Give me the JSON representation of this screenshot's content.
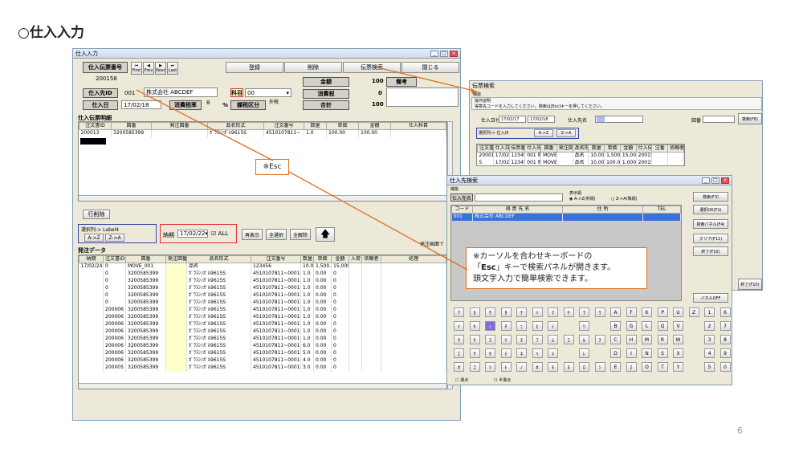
{
  "slide": {
    "title": "○仕入入力",
    "page": "6"
  },
  "main": {
    "title": "仕入入力",
    "denpyo_label": "仕入伝票番号",
    "denpyo_value": "200158",
    "nav": [
      "First",
      "Prev",
      "Next",
      "Last"
    ],
    "buttons": {
      "register": "登録",
      "delete": "削除",
      "search": "伝票検索",
      "close": "閉じる",
      "redisplay": "再表示",
      "selectall": "全選択",
      "clearall": "全解除",
      "rowdelete": "行削除"
    },
    "supplier_label": "仕入先ID",
    "supplier_id": "001",
    "supplier_name": "株式会社 ABCDEF",
    "kamoku_label": "科目",
    "kamoku_value": "00",
    "date_label": "仕入日",
    "date_value": "17/02/18",
    "tax_rate_label": "消費税率",
    "tax_rate_value": "8",
    "percent": "%",
    "tax_class_label": "課税区分",
    "tax_class_value": "外税",
    "kingaku_label": "金額",
    "kingaku_value": "100",
    "biko_label": "備考",
    "shohizei_label": "消費税",
    "shohizei_value": "0",
    "gokei_label": "合計",
    "gokei_value": "100",
    "detail_title": "仕入伝票明細",
    "detail_headers": [
      "注文書ID",
      "図番",
      "発注図番",
      "品名形式",
      "注文番号",
      "数量",
      "単価",
      "金額",
      "仕入科目"
    ],
    "detail_rows": [
      [
        "200013",
        "3200585399",
        "",
        "ｶﾞﾗｽｼﾝｶﾞﾙ9615S",
        "4510107811~",
        "1.0",
        "100.00",
        "100.00",
        ""
      ]
    ],
    "select_label": "選択列-> Label4",
    "sort_az": "A->Z",
    "sort_za": "Z->A",
    "nouki_label": "納期",
    "nouki_value": "17/02/22",
    "all_label": "ALL",
    "order_screen": "発注画面で",
    "order_title": "発注データ",
    "order_headers": [
      "納期",
      "注文書ID",
      "図番",
      "発注図番",
      "品名形式",
      "注文番号",
      "数量",
      "単価",
      "金額",
      "入荷",
      "依頼者",
      "処理"
    ],
    "order_rows": [
      [
        "17/02/24",
        "0",
        "MOVE_001",
        "",
        "品名",
        "123456",
        "10.0",
        "1,500.00",
        "15,000",
        "",
        "",
        ""
      ],
      [
        "",
        "0",
        "3200585399",
        "",
        "ｶﾞﾗｽｼﾝｶﾞﾙ9615S",
        "4510107811~00010",
        "1.0",
        "0.00",
        "0",
        "",
        "",
        ""
      ],
      [
        "",
        "0",
        "3200585399",
        "",
        "ｶﾞﾗｽｼﾝｶﾞﾙ9615S",
        "4510107811~00010",
        "1.0",
        "0.00",
        "0",
        "",
        "",
        ""
      ],
      [
        "",
        "0",
        "3200585399",
        "",
        "ｶﾞﾗｽｼﾝｶﾞﾙ9615S",
        "4510107811~00010",
        "1.0",
        "0.00",
        "0",
        "",
        "",
        ""
      ],
      [
        "",
        "0",
        "3200585399",
        "",
        "ｶﾞﾗｽｼﾝｶﾞﾙ9615S",
        "4510107811~00010",
        "1.0",
        "0.00",
        "0",
        "",
        "",
        ""
      ],
      [
        "",
        "0",
        "3200585399",
        "",
        "ｶﾞﾗｽｼﾝｶﾞﾙ9615S",
        "4510107811~00010",
        "1.0",
        "0.00",
        "0",
        "",
        "",
        ""
      ],
      [
        "",
        "200006",
        "3200585399",
        "",
        "ｶﾞﾗｽｼﾝｶﾞﾙ9615S",
        "4510107811~00010",
        "1.0",
        "0.00",
        "0",
        "",
        "",
        ""
      ],
      [
        "",
        "200006",
        "3200585399",
        "",
        "ｶﾞﾗｽｼﾝｶﾞﾙ9615S",
        "4510107811~00010",
        "1.0",
        "0.00",
        "0",
        "",
        "",
        ""
      ],
      [
        "",
        "200006",
        "3200585399",
        "",
        "ｶﾞﾗｽｼﾝｶﾞﾙ9615S",
        "4510107811~00010",
        "1.0",
        "0.00",
        "0",
        "",
        "",
        ""
      ],
      [
        "",
        "200006",
        "3200585399",
        "",
        "ｶﾞﾗｽｼﾝｶﾞﾙ9615S",
        "4510107811~00010",
        "1.0",
        "0.00",
        "0",
        "",
        "",
        ""
      ],
      [
        "",
        "200006",
        "3200585399",
        "",
        "ｶﾞﾗｽｼﾝｶﾞﾙ9615S",
        "4510107811~00010",
        "1.0",
        "0.00",
        "0",
        "",
        "",
        ""
      ],
      [
        "",
        "200006",
        "3200585399",
        "",
        "ｶﾞﾗｽｼﾝｶﾞﾙ9615S",
        "4510107811~00010",
        "6.0",
        "0.00",
        "0",
        "",
        "",
        ""
      ],
      [
        "",
        "200006",
        "3200585399",
        "",
        "ｶﾞﾗｽｼﾝｶﾞﾙ9615S",
        "4510107811~00010",
        "5.0",
        "0.00",
        "0",
        "",
        "",
        ""
      ],
      [
        "",
        "200006",
        "3200585399",
        "",
        "ｶﾞﾗｽｼﾝｶﾞﾙ9615S",
        "4510107811~00010",
        "4.0",
        "0.00",
        "0",
        "",
        "",
        ""
      ],
      [
        "",
        "200005",
        "3200585399",
        "",
        "ｶﾞﾗｽｼﾝｶﾞﾙ9615S",
        "4510107811~00010",
        "3.0",
        "0.00",
        "0",
        "",
        "",
        ""
      ]
    ]
  },
  "esc_callout": "※Esc",
  "denpyo_search": {
    "title": "伝票検索",
    "menu": "機能",
    "instruction_title": "操作説明",
    "instruction": "得意先コードを入力してください。検索は[Esc]キーを押してください。",
    "date_label": "仕入日付",
    "date_from": "17/02/17",
    "date_to": "17/02/18",
    "supplier_label": "仕入先名",
    "zuban_label": "図番",
    "search_btn": "検索(F8)",
    "select_label": "選択列-> 仕入日",
    "az": "A->Z",
    "za": "Z->A",
    "headers": [
      "注文書ID",
      "仕入日",
      "伝票番号",
      "仕入先名",
      "図番",
      "発注図番",
      "品名形式",
      "数量",
      "単価",
      "金額",
      "仕入伝票ID",
      "注番",
      "依頼者"
    ],
    "rows": [
      [
        "200016",
        "17/02/17",
        "123456",
        "001 株式会社 ABCDEF",
        "MOVE_001",
        "",
        "品名",
        "10.00",
        "1,500.00",
        "15,000",
        "200156",
        "",
        ""
      ],
      [
        "5",
        "17/02/17",
        "123456",
        "001 株式会社 ABCDEF",
        "MOVE_001",
        "",
        "品名",
        "10.00",
        "100.00",
        "1,000",
        "200155",
        "",
        ""
      ]
    ],
    "end_btn": "終了(F10)"
  },
  "tokui_search": {
    "title": "仕入先検索",
    "menu": "機能",
    "name_label": "仕入先名",
    "display_label": "表示順",
    "radio1": "A->Z(昇順)",
    "radio2": "Z->A(降順)",
    "headers": [
      "コード",
      "得 意 先 名",
      "住 所",
      "TEL"
    ],
    "rows": [
      [
        "001",
        "株式会社 ABCDEF",
        "",
        ""
      ]
    ],
    "buttons": [
      "検索(F3)",
      "選択OK(F1)",
      "検索パネル(F4)",
      "クリア(F11)",
      "終了(F10)"
    ],
    "panel_off": "パネルOFF",
    "kb_rows": [
      [
        "ｱ",
        "ｶ",
        "ｻ",
        "ﾀ",
        "ﾅ",
        "ﾊ",
        "ﾏ",
        "ﾔ",
        "ﾗ",
        "ﾜ",
        "A",
        "F",
        "K",
        "P",
        "U",
        "Z",
        "1",
        "6"
      ],
      [
        "ｲ",
        "ｷ",
        "ｼ",
        "ﾁ",
        "ﾆ",
        "ﾋ",
        "ﾐ",
        "",
        "ﾘ",
        "",
        "B",
        "G",
        "L",
        "Q",
        "V",
        "",
        "2",
        "7"
      ],
      [
        "ｳ",
        "ｸ",
        "ｽ",
        "ﾂ",
        "ﾇ",
        "ﾌ",
        "ﾑ",
        "ﾕ",
        "ﾙ",
        "ｦ",
        "C",
        "H",
        "M",
        "R",
        "W",
        "",
        "3",
        "8"
      ],
      [
        "ｴ",
        "ｹ",
        "ｾ",
        "ﾃ",
        "ﾈ",
        "ﾍ",
        "ﾒ",
        "",
        "ﾚ",
        "",
        "D",
        "I",
        "N",
        "S",
        "X",
        "",
        "4",
        "9"
      ],
      [
        "ｵ",
        "ｺ",
        "ｿ",
        "ﾄ",
        "ﾉ",
        "ﾎ",
        "ﾓ",
        "ﾖ",
        "ﾛ",
        "ﾝ",
        "E",
        "J",
        "O",
        "T",
        "Y",
        "",
        "5",
        "0"
      ]
    ],
    "dakuten": "濁点",
    "handakuten": "半濁点"
  },
  "callout": {
    "line1": "※カーソルを合わせキーボードの",
    "line2_pre": "「",
    "line2_key": "Esc",
    "line2_post": "」キーで検索パネルが開きます。",
    "line3": "頭文字入力で簡単検索できます。"
  },
  "colors": {
    "accent": "#e07020",
    "selected_row": "#3b72d9",
    "highlight": "#ffffcc"
  }
}
